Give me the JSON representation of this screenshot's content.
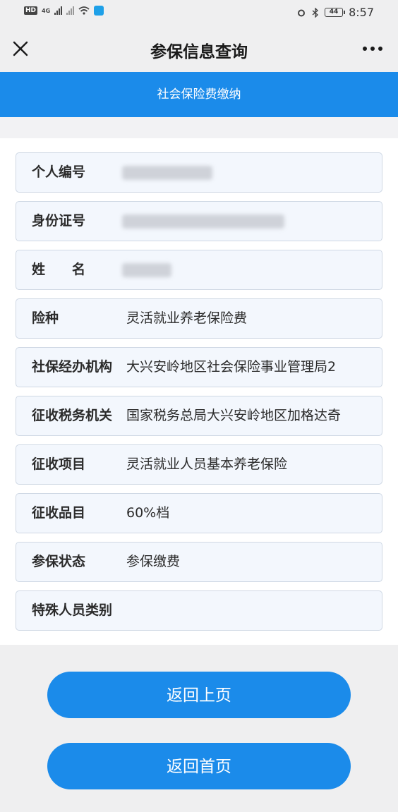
{
  "status_bar": {
    "left_badge": "HD",
    "net_type": "4G",
    "time": "8:57",
    "battery": "44"
  },
  "nav": {
    "title": "参保信息查询"
  },
  "banner": {
    "text": "社会保险费缴纳"
  },
  "fields": [
    {
      "label": "个人编号",
      "value": ""
    },
    {
      "label": "身份证号",
      "value": ""
    },
    {
      "label": "姓　　名",
      "value": ""
    },
    {
      "label": "险种",
      "value": "灵活就业养老保险费"
    },
    {
      "label": "社保经办机构",
      "value": "大兴安岭地区社会保险事业管理局2"
    },
    {
      "label": "征收税务机关",
      "value": "国家税务总局大兴安岭地区加格达奇"
    },
    {
      "label": "征收项目",
      "value": "灵活就业人员基本养老保险"
    },
    {
      "label": "征收品目",
      "value": "60%档"
    },
    {
      "label": "参保状态",
      "value": "参保缴费"
    },
    {
      "label": "特殊人员类别",
      "value": ""
    }
  ],
  "buttons": {
    "back_prev": "返回上页",
    "back_home": "返回首页"
  },
  "colors": {
    "accent": "#1b8bea",
    "row_bg": "#f3f7fd",
    "row_border": "#cfd8e4"
  }
}
